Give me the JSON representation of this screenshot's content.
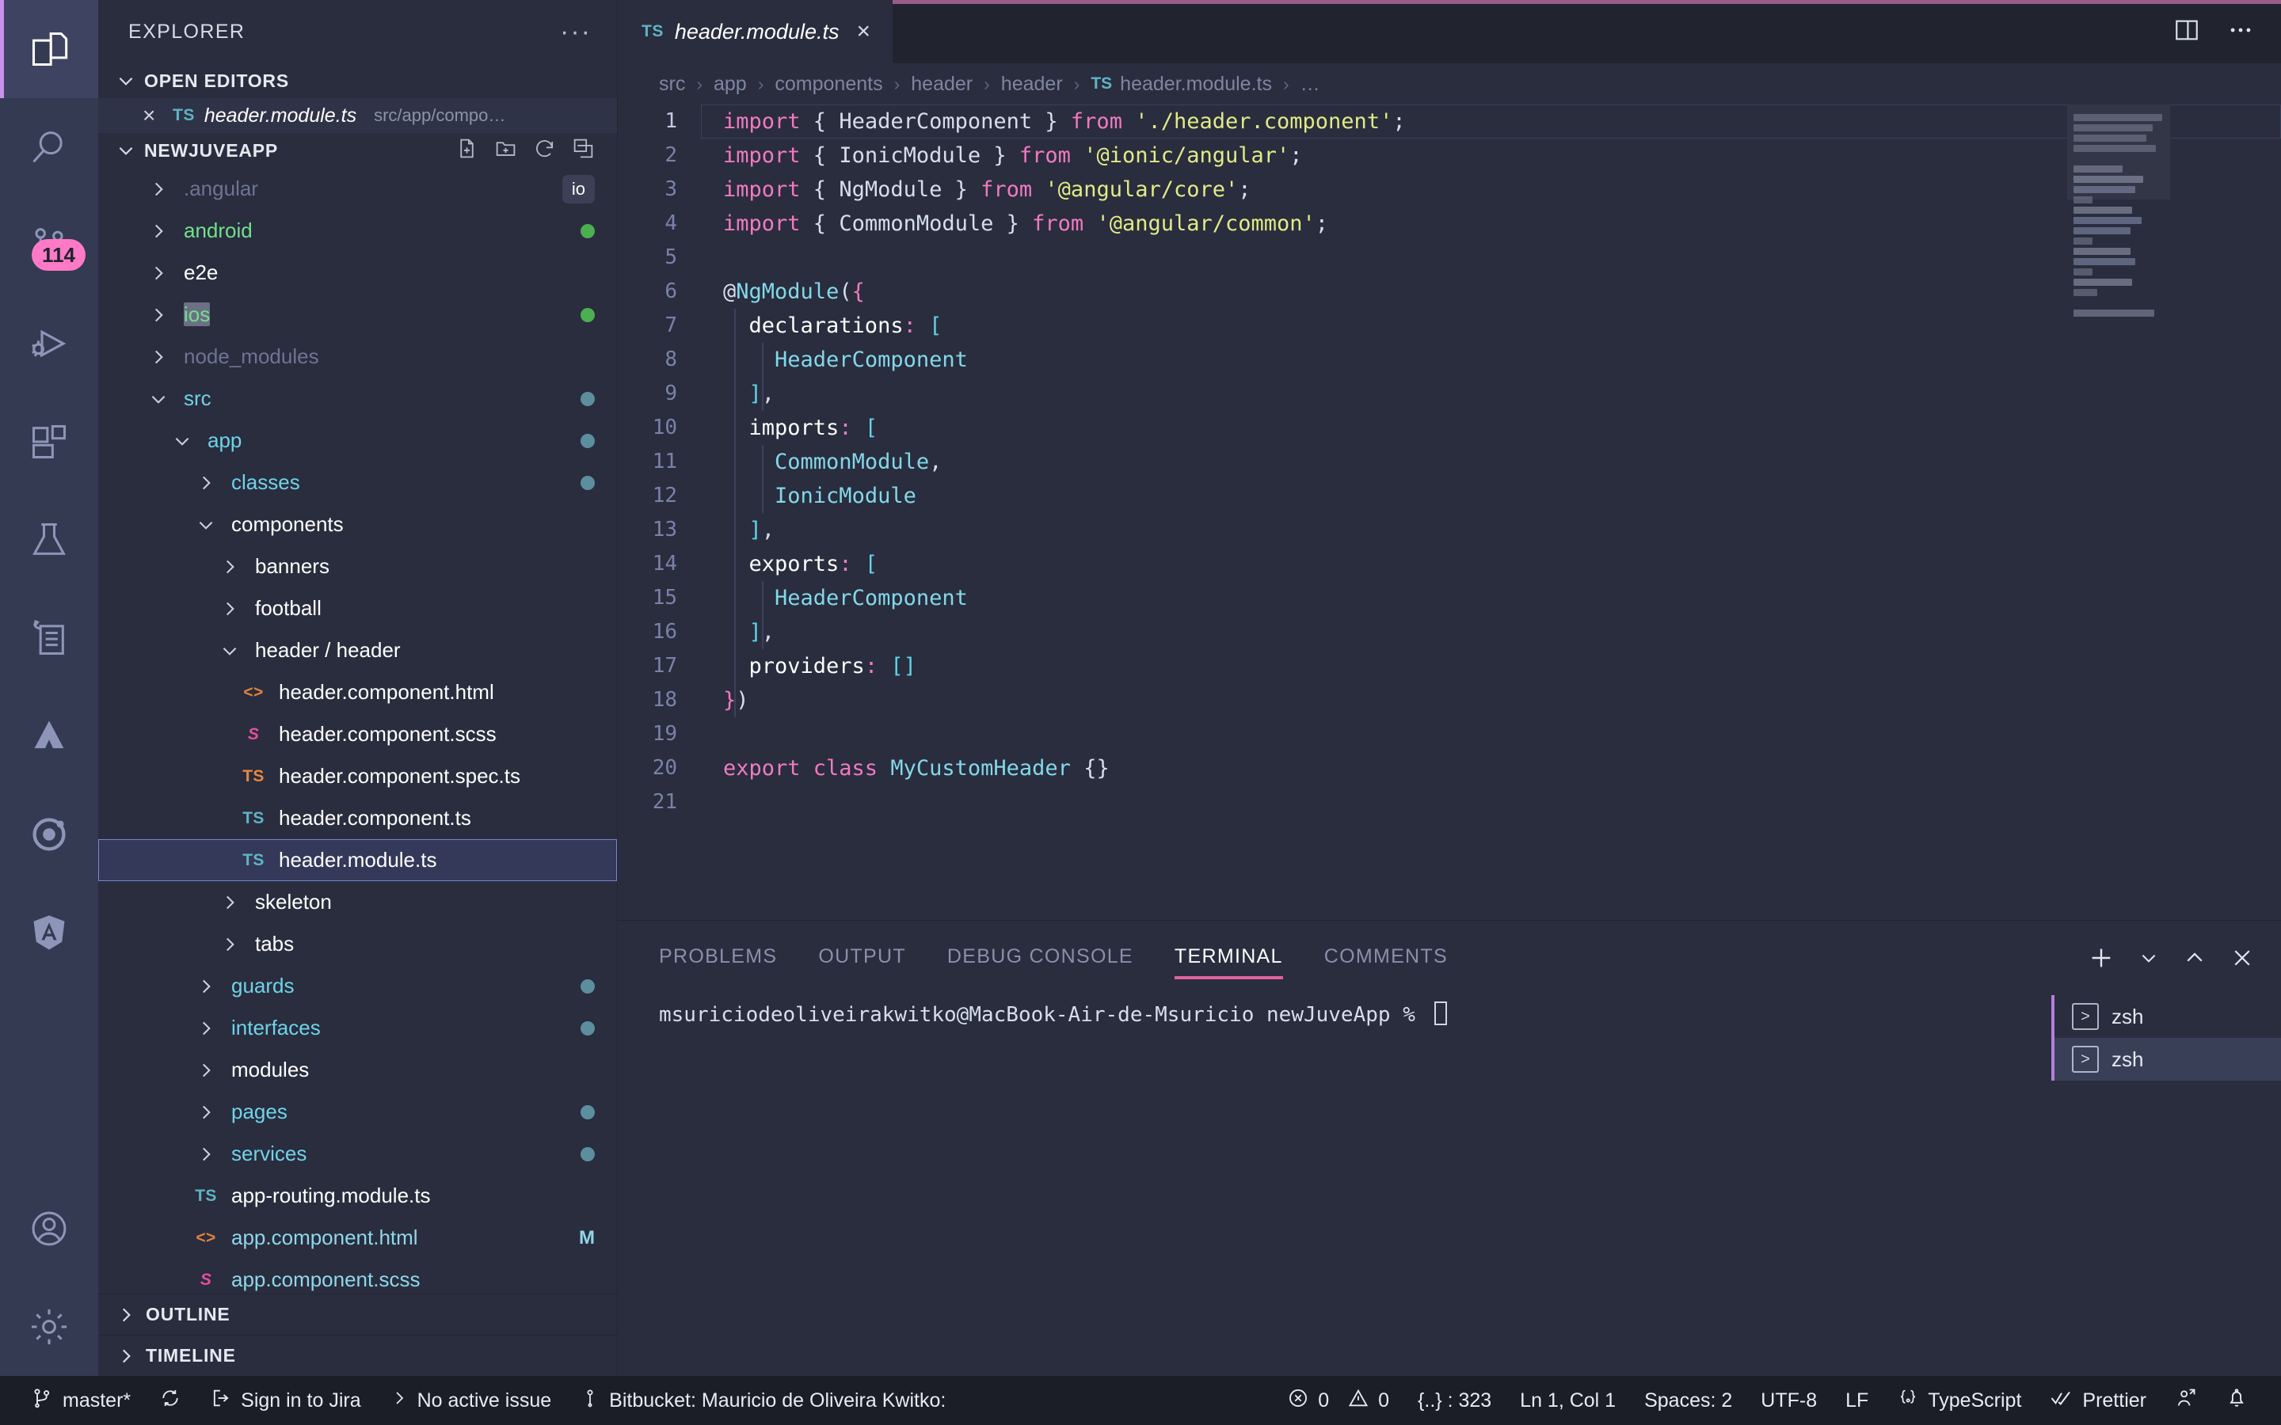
{
  "activity_bar": {
    "items": [
      {
        "name": "explorer",
        "icon": "files-icon",
        "active": true
      },
      {
        "name": "search",
        "icon": "search-icon",
        "active": false
      },
      {
        "name": "source-control",
        "icon": "source-control-icon",
        "active": false,
        "badge": "114"
      },
      {
        "name": "run-and-debug",
        "icon": "run-debug-icon",
        "active": false
      },
      {
        "name": "extensions",
        "icon": "extensions-icon",
        "active": false
      },
      {
        "name": "testing",
        "icon": "flask-icon",
        "active": false
      },
      {
        "name": "todo-tree",
        "icon": "todo-list-icon",
        "active": false
      },
      {
        "name": "atlassian",
        "icon": "atlassian-icon",
        "active": false
      },
      {
        "name": "ionic",
        "icon": "ionic-icon",
        "active": false
      },
      {
        "name": "angular",
        "icon": "angular-shield-icon",
        "active": false
      }
    ],
    "bottom": [
      {
        "name": "accounts",
        "icon": "account-icon"
      },
      {
        "name": "manage",
        "icon": "gear-icon"
      }
    ]
  },
  "sidebar": {
    "title": "EXPLORER",
    "more_actions": "···",
    "open_editors": {
      "label": "OPEN EDITORS",
      "items": [
        {
          "close": "×",
          "badge": "TS",
          "name": "header.module.ts",
          "path": "src/app/compo…"
        }
      ]
    },
    "workspace": {
      "label": "NEWJUVEAPP",
      "actions": [
        "new-file-icon",
        "new-folder-icon",
        "refresh-icon",
        "collapse-all-icon"
      ],
      "tree": [
        {
          "label": ".angular",
          "type": "folder",
          "expanded": false,
          "indent": 1,
          "color": "#6e7494",
          "badge": "io"
        },
        {
          "label": "android",
          "type": "folder",
          "expanded": false,
          "indent": 1,
          "color": "#73e08a",
          "dot": "#4caf50"
        },
        {
          "label": "e2e",
          "type": "folder",
          "expanded": false,
          "indent": 1,
          "color": "#ffffff"
        },
        {
          "label": "ios",
          "type": "folder",
          "expanded": false,
          "indent": 1,
          "color": "#73e08a",
          "dot": "#4caf50",
          "highlight": true
        },
        {
          "label": "node_modules",
          "type": "folder",
          "expanded": false,
          "indent": 1,
          "color": "#6e7494"
        },
        {
          "label": "src",
          "type": "folder",
          "expanded": true,
          "indent": 1,
          "color": "#6fd3e8",
          "dot": "#5d8e9e"
        },
        {
          "label": "app",
          "type": "folder",
          "expanded": true,
          "indent": 2,
          "color": "#6fd3e8",
          "dot": "#5d8e9e"
        },
        {
          "label": "classes",
          "type": "folder",
          "expanded": false,
          "indent": 3,
          "color": "#6fd3e8",
          "dot": "#5d8e9e"
        },
        {
          "label": "components",
          "type": "folder",
          "expanded": true,
          "indent": 3,
          "color": "#ffffff"
        },
        {
          "label": "banners",
          "type": "folder",
          "expanded": false,
          "indent": 4,
          "color": "#ffffff"
        },
        {
          "label": "football",
          "type": "folder",
          "expanded": false,
          "indent": 4,
          "color": "#ffffff"
        },
        {
          "label": "header / header",
          "type": "folder",
          "expanded": true,
          "indent": 4,
          "color": "#ffffff"
        },
        {
          "label": "header.component.html",
          "type": "file",
          "icon": "html-icon",
          "indent": 5,
          "color": "#ffffff"
        },
        {
          "label": "header.component.scss",
          "type": "file",
          "icon": "scss-icon",
          "indent": 5,
          "color": "#ffffff"
        },
        {
          "label": "header.component.spec.ts",
          "type": "file",
          "icon": "ts-orange-icon",
          "indent": 5,
          "color": "#ffffff"
        },
        {
          "label": "header.component.ts",
          "type": "file",
          "icon": "ts-icon",
          "indent": 5,
          "color": "#ffffff"
        },
        {
          "label": "header.module.ts",
          "type": "file",
          "icon": "ts-icon",
          "indent": 5,
          "color": "#ffffff",
          "selected": true
        },
        {
          "label": "skeleton",
          "type": "folder",
          "expanded": false,
          "indent": 4,
          "color": "#ffffff"
        },
        {
          "label": "tabs",
          "type": "folder",
          "expanded": false,
          "indent": 4,
          "color": "#ffffff"
        },
        {
          "label": "guards",
          "type": "folder",
          "expanded": false,
          "indent": 3,
          "color": "#6fd3e8",
          "dot": "#5d8e9e"
        },
        {
          "label": "interfaces",
          "type": "folder",
          "expanded": false,
          "indent": 3,
          "color": "#6fd3e8",
          "dot": "#5d8e9e"
        },
        {
          "label": "modules",
          "type": "folder",
          "expanded": false,
          "indent": 3,
          "color": "#ffffff"
        },
        {
          "label": "pages",
          "type": "folder",
          "expanded": false,
          "indent": 3,
          "color": "#6fd3e8",
          "dot": "#5d8e9e"
        },
        {
          "label": "services",
          "type": "folder",
          "expanded": false,
          "indent": 3,
          "color": "#6fd3e8",
          "dot": "#5d8e9e"
        },
        {
          "label": "app-routing.module.ts",
          "type": "file",
          "icon": "ts-icon",
          "indent": 3,
          "color": "#ffffff"
        },
        {
          "label": "app.component.html",
          "type": "file",
          "icon": "html-icon",
          "indent": 3,
          "color": "#8fd7e8",
          "mark": "M"
        },
        {
          "label": "app.component.scss",
          "type": "file",
          "icon": "scss-icon",
          "indent": 3,
          "color": "#8fd7e8"
        }
      ]
    },
    "outline": "OUTLINE",
    "timeline": "TIMELINE"
  },
  "editor": {
    "tab": {
      "badge": "TS",
      "title": "header.module.ts",
      "close": "×"
    },
    "tab_actions": [
      "split-editor-icon",
      "more-actions-icon"
    ],
    "breadcrumb": [
      "src",
      "app",
      "components",
      "header",
      "header"
    ],
    "breadcrumb_file": {
      "badge": "TS",
      "name": "header.module.ts"
    },
    "breadcrumb_tail": "…",
    "lines": [
      {
        "n": 1,
        "current": true,
        "tokens": [
          {
            "t": "import",
            "c": "kw"
          },
          {
            "t": " { HeaderComponent } ",
            "c": "plain"
          },
          {
            "t": "from",
            "c": "kw"
          },
          {
            "t": " ",
            "c": "plain"
          },
          {
            "t": "'./header.component'",
            "c": "str"
          },
          {
            "t": ";",
            "c": "plain"
          }
        ]
      },
      {
        "n": 2,
        "tokens": [
          {
            "t": "import",
            "c": "kw"
          },
          {
            "t": " { IonicModule } ",
            "c": "plain"
          },
          {
            "t": "from",
            "c": "kw"
          },
          {
            "t": " ",
            "c": "plain"
          },
          {
            "t": "'@ionic/angular'",
            "c": "str"
          },
          {
            "t": ";",
            "c": "plain"
          }
        ]
      },
      {
        "n": 3,
        "tokens": [
          {
            "t": "import",
            "c": "kw"
          },
          {
            "t": " { NgModule } ",
            "c": "plain"
          },
          {
            "t": "from",
            "c": "kw"
          },
          {
            "t": " ",
            "c": "plain"
          },
          {
            "t": "'@angular/core'",
            "c": "str"
          },
          {
            "t": ";",
            "c": "plain"
          }
        ]
      },
      {
        "n": 4,
        "tokens": [
          {
            "t": "import",
            "c": "kw"
          },
          {
            "t": " { CommonModule } ",
            "c": "plain"
          },
          {
            "t": "from",
            "c": "kw"
          },
          {
            "t": " ",
            "c": "plain"
          },
          {
            "t": "'@angular/common'",
            "c": "str"
          },
          {
            "t": ";",
            "c": "plain"
          }
        ]
      },
      {
        "n": 5,
        "tokens": []
      },
      {
        "n": 6,
        "tokens": [
          {
            "t": "@",
            "c": "plain"
          },
          {
            "t": "NgModule",
            "c": "cls"
          },
          {
            "t": "(",
            "c": "plain"
          },
          {
            "t": "{",
            "c": "kw"
          }
        ]
      },
      {
        "n": 7,
        "tokens": [
          {
            "t": "  declarations",
            "c": "prop"
          },
          {
            "t": ":",
            "c": "kw"
          },
          {
            "t": " ",
            "c": "plain"
          },
          {
            "t": "[",
            "c": "brk"
          }
        ]
      },
      {
        "n": 8,
        "tokens": [
          {
            "t": "    ",
            "c": "plain"
          },
          {
            "t": "HeaderComponent",
            "c": "cls"
          }
        ]
      },
      {
        "n": 9,
        "tokens": [
          {
            "t": "  ",
            "c": "plain"
          },
          {
            "t": "]",
            "c": "brk"
          },
          {
            "t": ",",
            "c": "plain"
          }
        ]
      },
      {
        "n": 10,
        "tokens": [
          {
            "t": "  imports",
            "c": "prop"
          },
          {
            "t": ":",
            "c": "kw"
          },
          {
            "t": " ",
            "c": "plain"
          },
          {
            "t": "[",
            "c": "brk"
          }
        ]
      },
      {
        "n": 11,
        "tokens": [
          {
            "t": "    ",
            "c": "plain"
          },
          {
            "t": "CommonModule",
            "c": "cls"
          },
          {
            "t": ",",
            "c": "plain"
          }
        ]
      },
      {
        "n": 12,
        "tokens": [
          {
            "t": "    ",
            "c": "plain"
          },
          {
            "t": "IonicModule",
            "c": "cls"
          }
        ]
      },
      {
        "n": 13,
        "tokens": [
          {
            "t": "  ",
            "c": "plain"
          },
          {
            "t": "]",
            "c": "brk"
          },
          {
            "t": ",",
            "c": "plain"
          }
        ]
      },
      {
        "n": 14,
        "tokens": [
          {
            "t": "  exports",
            "c": "prop"
          },
          {
            "t": ":",
            "c": "kw"
          },
          {
            "t": " ",
            "c": "plain"
          },
          {
            "t": "[",
            "c": "brk"
          }
        ]
      },
      {
        "n": 15,
        "tokens": [
          {
            "t": "    ",
            "c": "plain"
          },
          {
            "t": "HeaderComponent",
            "c": "cls"
          }
        ]
      },
      {
        "n": 16,
        "tokens": [
          {
            "t": "  ",
            "c": "plain"
          },
          {
            "t": "]",
            "c": "brk"
          },
          {
            "t": ",",
            "c": "plain"
          }
        ]
      },
      {
        "n": 17,
        "tokens": [
          {
            "t": "  providers",
            "c": "prop"
          },
          {
            "t": ":",
            "c": "kw"
          },
          {
            "t": " ",
            "c": "plain"
          },
          {
            "t": "[]",
            "c": "brk"
          }
        ]
      },
      {
        "n": 18,
        "tokens": [
          {
            "t": "}",
            "c": "kw"
          },
          {
            "t": ")",
            "c": "plain"
          }
        ]
      },
      {
        "n": 19,
        "tokens": []
      },
      {
        "n": 20,
        "tokens": [
          {
            "t": "export class",
            "c": "kw"
          },
          {
            "t": " ",
            "c": "plain"
          },
          {
            "t": "MyCustomHeader",
            "c": "cls"
          },
          {
            "t": " ",
            "c": "plain"
          },
          {
            "t": "{}",
            "c": "plain"
          }
        ]
      },
      {
        "n": 21,
        "tokens": []
      }
    ]
  },
  "panel": {
    "tabs": [
      {
        "label": "PROBLEMS",
        "active": false
      },
      {
        "label": "OUTPUT",
        "active": false
      },
      {
        "label": "DEBUG CONSOLE",
        "active": false
      },
      {
        "label": "TERMINAL",
        "active": true
      },
      {
        "label": "COMMENTS",
        "active": false
      }
    ],
    "actions": [
      "new-terminal-icon",
      "chevron-down-icon",
      "maximize-panel-icon",
      "close-panel-icon"
    ],
    "terminal_text": "msuriciodeoliveirakwitko@MacBook-Air-de-Msuricio newJuveApp % ",
    "terminal_list": [
      {
        "label": "zsh",
        "active": false
      },
      {
        "label": "zsh",
        "active": true
      }
    ]
  },
  "statusbar": {
    "left": [
      {
        "icon": "source-control-icon",
        "label": "master*"
      },
      {
        "icon": "sync-icon",
        "label": ""
      },
      {
        "icon": "jira-icon",
        "label": "Sign in to Jira"
      },
      {
        "icon": "chevron-right-icon",
        "label": "No active issue"
      },
      {
        "icon": "bitbucket-icon",
        "label": "Bitbucket: Mauricio de Oliveira Kwitko:"
      }
    ],
    "right": [
      {
        "icon": "error-icon",
        "label": "0",
        "icon2": "warning-icon",
        "label2": "0"
      },
      {
        "icon": "",
        "label": "{..} : 323"
      },
      {
        "icon": "",
        "label": "Ln 1, Col 1"
      },
      {
        "icon": "",
        "label": "Spaces: 2"
      },
      {
        "icon": "",
        "label": "UTF-8"
      },
      {
        "icon": "",
        "label": "LF"
      },
      {
        "icon": "braces-icon",
        "label": "TypeScript"
      },
      {
        "icon": "check-icon",
        "label": "Prettier"
      },
      {
        "icon": "feedback-icon",
        "label": ""
      },
      {
        "icon": "bell-icon",
        "label": ""
      }
    ]
  },
  "colors": {
    "accent": "#c792ea",
    "badge": "#ff7ac6",
    "tab_top_border": "#9a5b8b",
    "panel_active": "#e0619e",
    "bg": "#292d3e",
    "activitybar": "#343a51",
    "statusbar": "#1b1d27"
  }
}
